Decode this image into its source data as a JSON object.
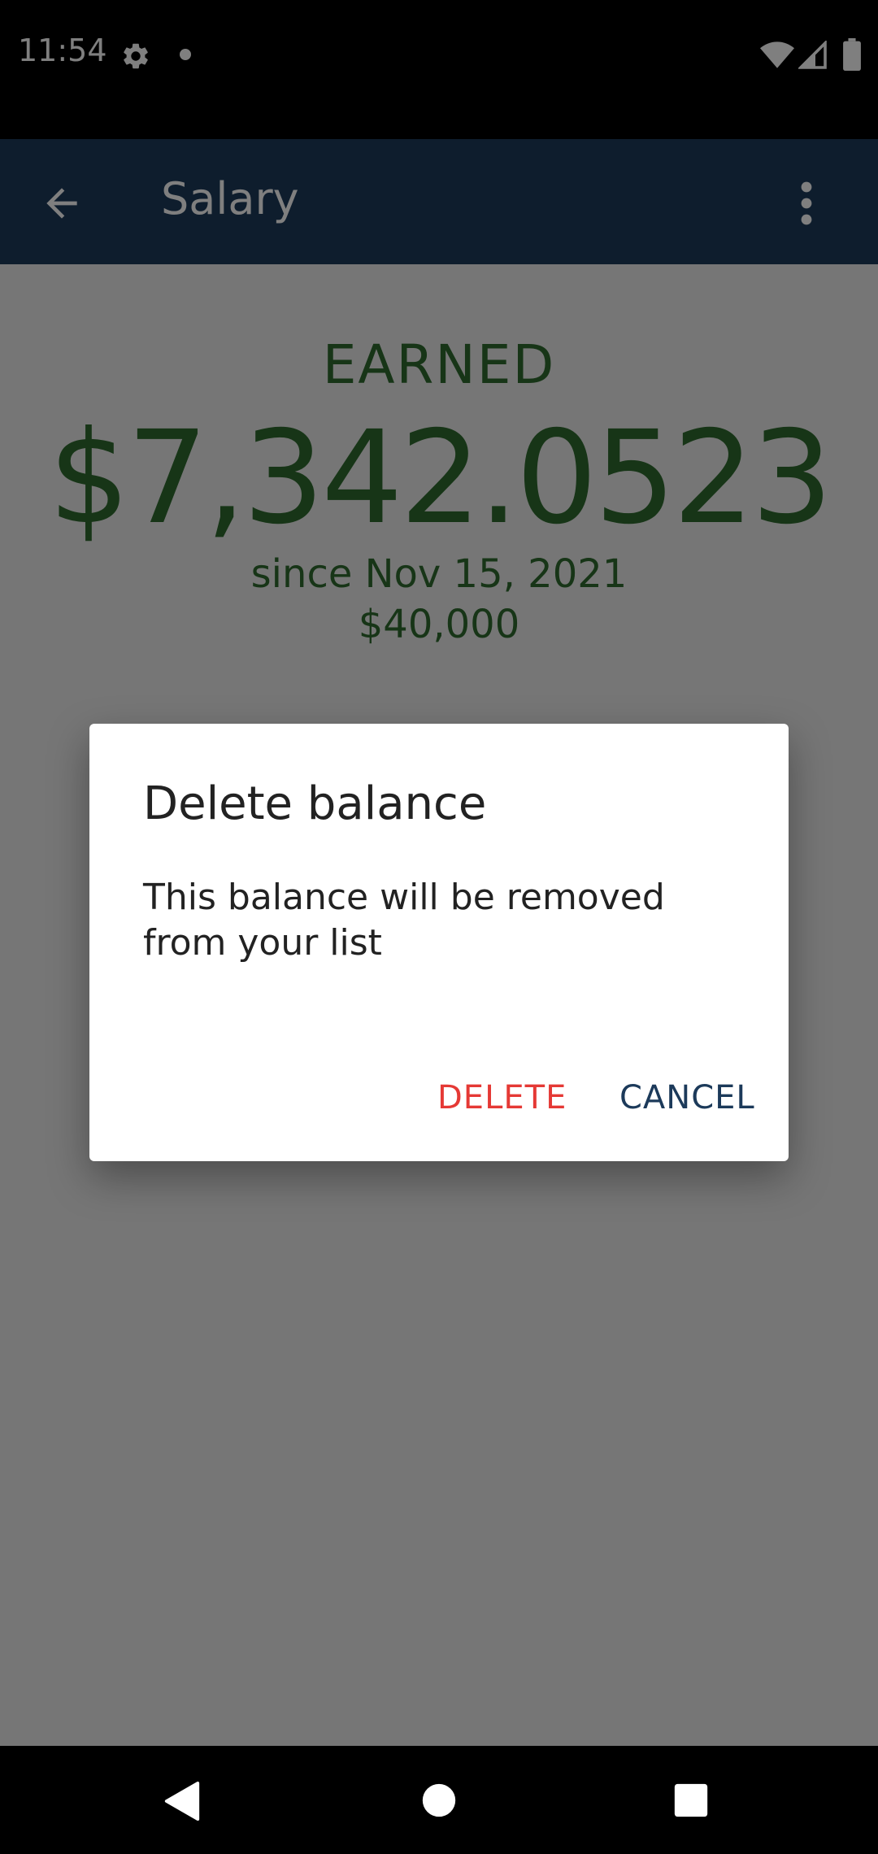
{
  "status_bar": {
    "time": "11:54",
    "icons": [
      "gear-icon",
      "notification-dot-icon",
      "wifi-icon",
      "signal-icon",
      "battery-icon"
    ]
  },
  "app_bar": {
    "title": "Salary",
    "back_icon": "arrow-back-icon",
    "menu_icon": "more-vert-icon",
    "background": "#1c3a5a"
  },
  "balance": {
    "label": "EARNED",
    "amount": "$7,342.0523",
    "since": "since Nov 15, 2021",
    "salary": "$40,000",
    "color": "#2e6b2e"
  },
  "dialog": {
    "title": "Delete balance",
    "message": "This balance will be removed from your list",
    "delete_label": "DELETE",
    "cancel_label": "CANCEL",
    "delete_color": "#e53935",
    "cancel_color": "#1c3a5a"
  },
  "nav_bar": {
    "icons": [
      "nav-back-icon",
      "nav-home-icon",
      "nav-recents-icon"
    ]
  }
}
